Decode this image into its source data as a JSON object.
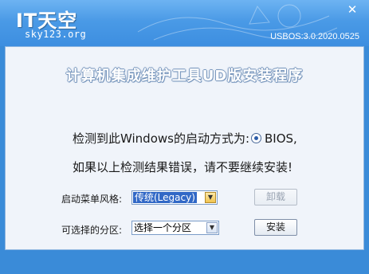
{
  "window": {
    "logo_main": "IT天空",
    "logo_sub": "sky123.org",
    "version": "USBOS:3.0.2020.0525",
    "close_icon": "close-icon",
    "colors": {
      "titlebar": "#4a9ae6",
      "frame": "#3a8bd8",
      "client": "#f0f4fa",
      "selection": "#3168c6"
    }
  },
  "main": {
    "heading": "计算机集成维护工具UD版安装程序",
    "boot_mode_prefix": "检测到此Windows的启动方式为:",
    "boot_mode_value": "BIOS,",
    "warning": "如果以上检测结果错误，请不要继续安装!",
    "boot_menu_style": {
      "label": "启动菜单风格:",
      "selected": "传统(Legacy)"
    },
    "partition": {
      "label": "可选择的分区:",
      "selected": "选择一个分区"
    },
    "uninstall_label": "卸载",
    "install_label": "安装"
  }
}
